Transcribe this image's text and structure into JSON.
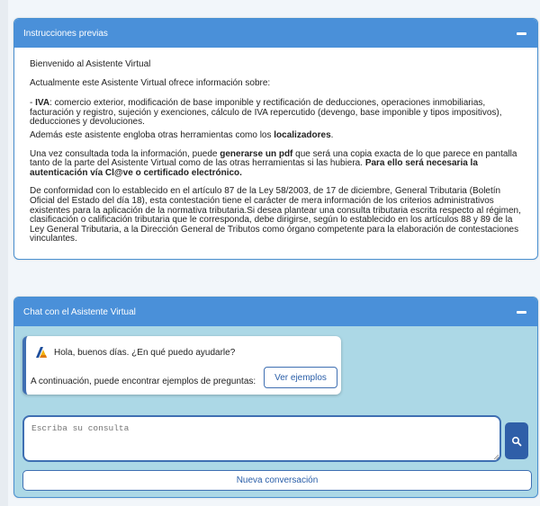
{
  "instructions": {
    "title": "Instrucciones previas",
    "welcome": "Bienvenido al Asistente Virtual",
    "intro": "Actualmente este Asistente Virtual ofrece información sobre:",
    "iva_label": "IVA",
    "iva_text": ": comercio exterior, modificación de base imponible y rectificación de deducciones, operaciones inmobiliarias, facturación y registro, sujeción y exenciones, cálculo de IVA repercutido (devengo, base imponible y tipos impositivos), deducciones y devoluciones.",
    "tools_prefix": "Además este asistente engloba otras herramientas como los ",
    "tools_bold": "localizadores",
    "tools_suffix": ".",
    "pdf_prefix": "Una vez consultada toda la información, puede ",
    "pdf_bold": "generarse un pdf",
    "pdf_mid": " que será una copia exacta de lo que parece en pantalla tanto de la parte del Asistente Virtual como de las otras herramientas si las hubiera. ",
    "pdf_bold2": "Para ello será necesaria la autenticación vía Cl@ve o certificado electrónico.",
    "legal": "De conformidad con lo establecido en el artículo 87 de la Ley 58/2003, de 17 de diciembre, General Tributaria (Boletín Oficial del Estado del día 18), esta contestación tiene el carácter de mera información de los criterios administrativos existentes para la aplicación de la normativa tributaria.Si desea plantear una consulta tributaria escrita respecto al régimen, clasificación o calificación tributaria que le corresponda, debe dirigirse, según lo establecido en los artículos 88 y 89 de la Ley General Tributaria, a la Dirección General de Tributos como órgano competente para la elaboración de contestaciones vinculantes."
  },
  "chat": {
    "title": "Chat con el Asistente Virtual",
    "greeting": "Hola, buenos días. ¿En qué puedo ayudarle?",
    "examples_text": "A continuación, puede encontrar ejemplos de preguntas:",
    "examples_button": "Ver ejemplos",
    "input_placeholder": "Escriba su consulta",
    "new_conversation": "Nueva conversación"
  },
  "colors": {
    "header": "#4a90d9",
    "chat_bg": "#acd8e6",
    "accent": "#3f6fb2"
  },
  "icons": [
    "collapse-icon",
    "agency-logo-icon",
    "search-icon",
    "resize-grip-icon"
  ]
}
